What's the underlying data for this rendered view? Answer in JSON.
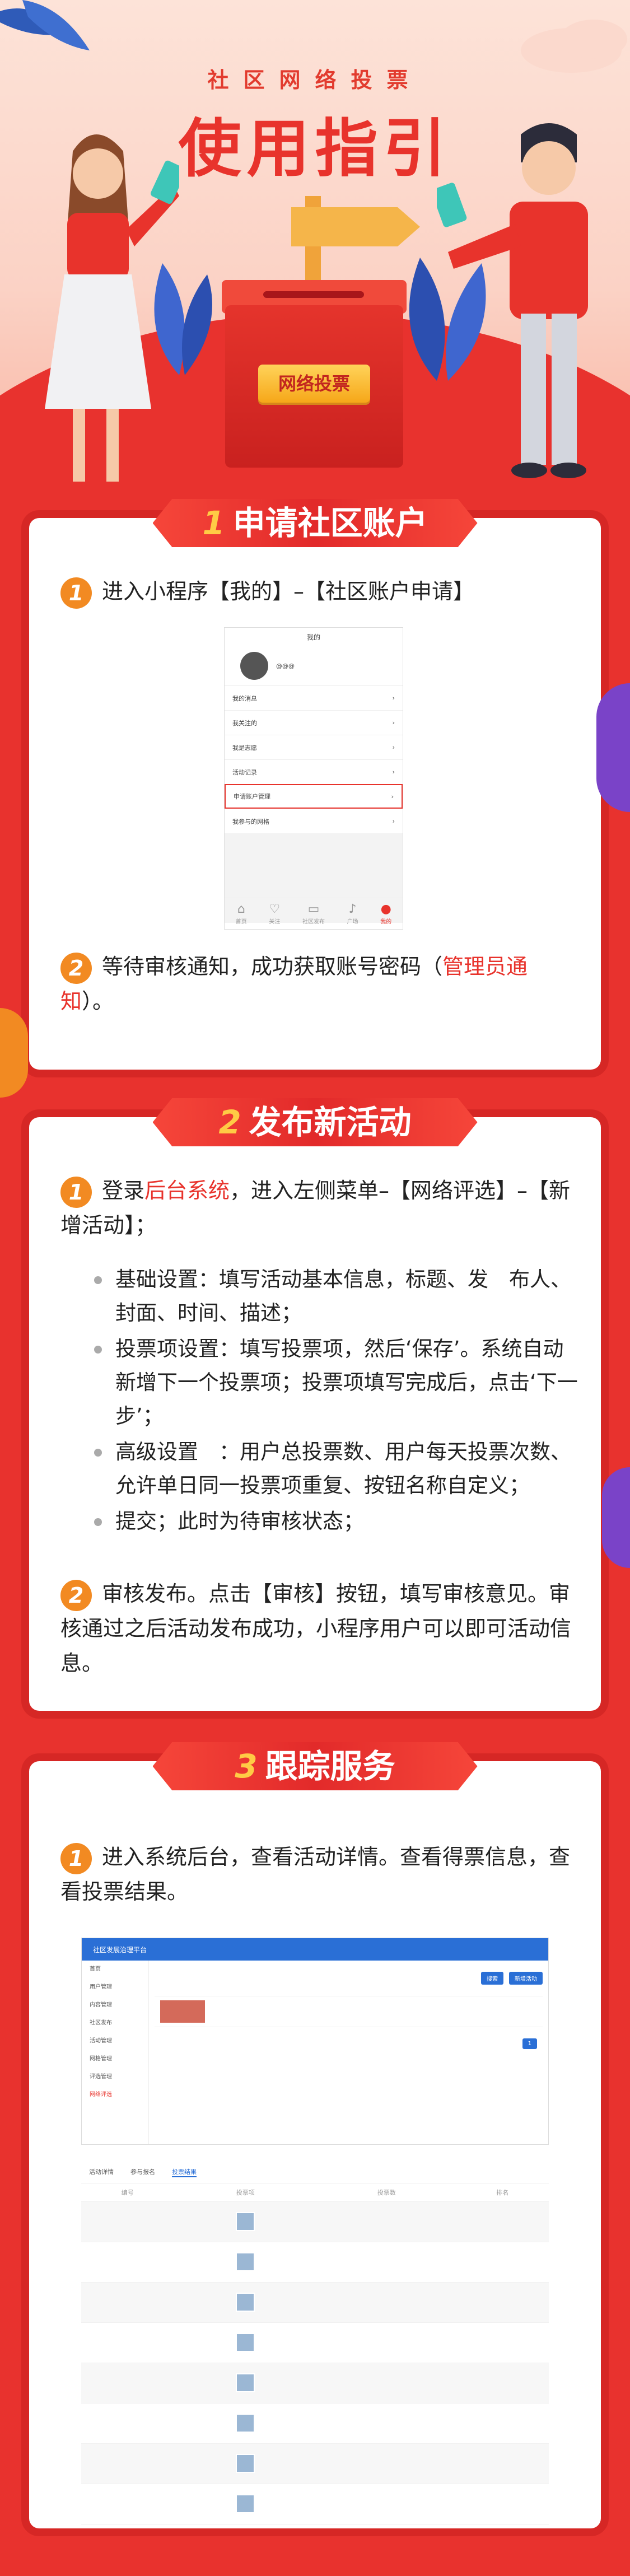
{
  "header": {
    "subtitle": "社区网络投票",
    "title": "使用指引",
    "badge": "网络投票"
  },
  "section1": {
    "num": "1",
    "title": "申请社区账户",
    "step1_no": "1",
    "step1_text": "进入小程序【我的】–【社区账户申请】",
    "step2_no": "2",
    "step2_prefix": "等待审核通知，成功获取账号密码（",
    "step2_link": "管理员通知",
    "step2_suffix": "）。",
    "phone": {
      "title": "我的",
      "name": "@@@",
      "items": [
        "我的消息",
        "我关注的",
        "我是志愿",
        "活动记录",
        "申请账户管理",
        "我参与的网格"
      ],
      "tabs": [
        "首页",
        "关注",
        "社区发布",
        "广场",
        "我的"
      ]
    }
  },
  "section2": {
    "num": "2",
    "title": "发布新活动",
    "step1_no": "1",
    "step1_pre": "登录",
    "step1_link": "后台系统",
    "step1_post": "，进入左侧菜单–【网络评选】–【新增活动】；",
    "bullets": [
      "基础设置：填写活动基本信息，标题、发　布人、封面、时间、描述；",
      "投票项设置：填写投票项，然后‘保存’。系统自动新增下一个投票项；投票项填写完成后，点击‘下一步’；",
      "高级设置　：用户总投票数、用户每天投票次数、允许单日同一投票项重复、按钮名称自定义；",
      "提交；此时为待审核状态；"
    ],
    "step2_no": "2",
    "step2_text": "审核发布。点击【审核】按钮，填写审核意见。审核通过之后活动发布成功，小程序用户可以即可活动信息。"
  },
  "section3": {
    "num": "3",
    "title": "跟踪服务",
    "step1_no": "1",
    "step1_text": "进入系统后台，查看活动详情。查看得票信息，查看投票结果。",
    "admin": {
      "brand": "社区发展治理平台",
      "side": [
        "首页",
        "用户管理",
        "内容管理",
        "社区发布",
        "活动管理",
        "网格管理",
        "评选管理",
        "网络评选"
      ],
      "add_btn": "新增活动",
      "search_btn": "搜索"
    },
    "results": {
      "tabs": [
        "活动详情",
        "参与报名",
        "投票结果"
      ],
      "headers": [
        "编号",
        "投票项",
        "投票数",
        "排名"
      ]
    }
  }
}
